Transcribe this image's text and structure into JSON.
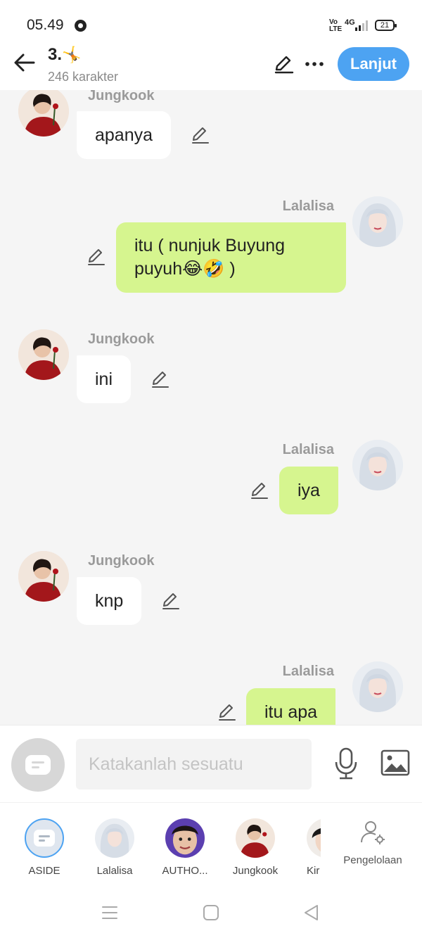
{
  "status_bar": {
    "time": "05.49",
    "volte": "Vo\nLTE",
    "network": "4G",
    "battery": "21"
  },
  "header": {
    "title": "3.",
    "title_emoji": "🤸",
    "subtitle": "246 karakter",
    "action_button": "Lanjut"
  },
  "messages": [
    {
      "sender": "Jungkook",
      "text": "apanya",
      "side": "left"
    },
    {
      "sender": "Lalalisa",
      "text": "itu ( nunjuk Buyung puyuh😂🤣 )",
      "side": "right"
    },
    {
      "sender": "Jungkook",
      "text": "ini",
      "side": "left"
    },
    {
      "sender": "Lalalisa",
      "text": "iya",
      "side": "right"
    },
    {
      "sender": "Jungkook",
      "text": "knp",
      "side": "left"
    },
    {
      "sender": "Lalalisa",
      "text": "itu apa",
      "side": "right"
    }
  ],
  "input": {
    "placeholder": "Katakanlah sesuatu",
    "value": ""
  },
  "characters": [
    {
      "label": "ASIDE"
    },
    {
      "label": "Lalalisa"
    },
    {
      "label": "AUTHO..."
    },
    {
      "label": "Jungkook"
    },
    {
      "label": "Kir"
    }
  ],
  "manage": {
    "label": "Pengelolaan"
  },
  "colors": {
    "accent": "#4da3f2",
    "own_bubble": "#d6f58f",
    "other_bubble": "#ffffff",
    "background": "#f5f5f5"
  },
  "icons": [
    "back-arrow-icon",
    "edit-pen-icon",
    "more-dots-icon",
    "aside-chat-icon",
    "microphone-icon",
    "image-icon",
    "manage-person-gear-icon",
    "nav-menu-icon",
    "nav-home-icon",
    "nav-back-icon"
  ]
}
